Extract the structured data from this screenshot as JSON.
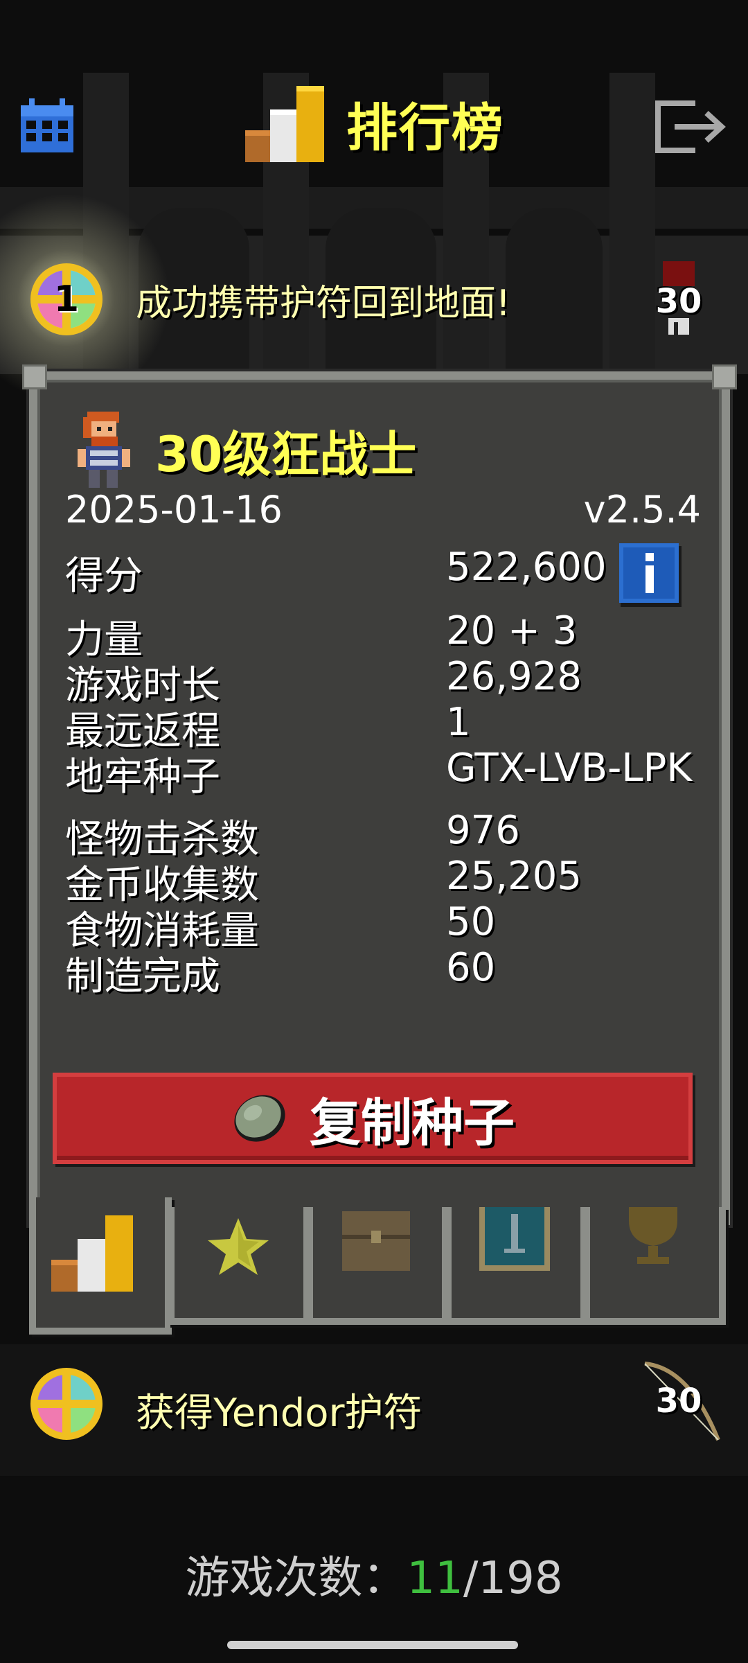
{
  "header": {
    "title": "排行榜"
  },
  "badges": [
    {
      "medal_number": "1",
      "text": "成功携带护符回到地面!",
      "depth": "30"
    },
    {
      "text": "获得Yendor护符",
      "depth": "30"
    }
  ],
  "record": {
    "hero_title": "30级狂战士",
    "date": "2025-01-16",
    "version": "v2.5.4",
    "stats": [
      {
        "label": "得分",
        "value": "522,600"
      },
      {
        "label": "力量",
        "value": "20 + 3"
      },
      {
        "label": "游戏时长",
        "value": "26,928"
      },
      {
        "label": "最远返程",
        "value": "1"
      },
      {
        "label": "地牢种子",
        "value": "GTX-LVB-LPK"
      },
      {
        "label": "怪物击杀数",
        "value": "976"
      },
      {
        "label": "金币收集数",
        "value": "25,205"
      },
      {
        "label": "食物消耗量",
        "value": "50"
      },
      {
        "label": "制造完成",
        "value": "60"
      }
    ],
    "copy_seed_label": "复制种子"
  },
  "tabs": [
    {
      "icon": "podium-icon",
      "active": true
    },
    {
      "icon": "star-icon",
      "active": false
    },
    {
      "icon": "chest-icon",
      "active": false
    },
    {
      "icon": "sword-card-icon",
      "active": false
    },
    {
      "icon": "trophy-icon",
      "active": false
    }
  ],
  "footer": {
    "prefix": "游戏次数：",
    "runs": "11",
    "total": "/198"
  },
  "colors": {
    "title_yellow": "#ffff55",
    "panel_bg": "#3e3e3c",
    "panel_border": "#8c8e89",
    "button_red": "#b8262a",
    "runs_green": "#3fbf3f"
  }
}
